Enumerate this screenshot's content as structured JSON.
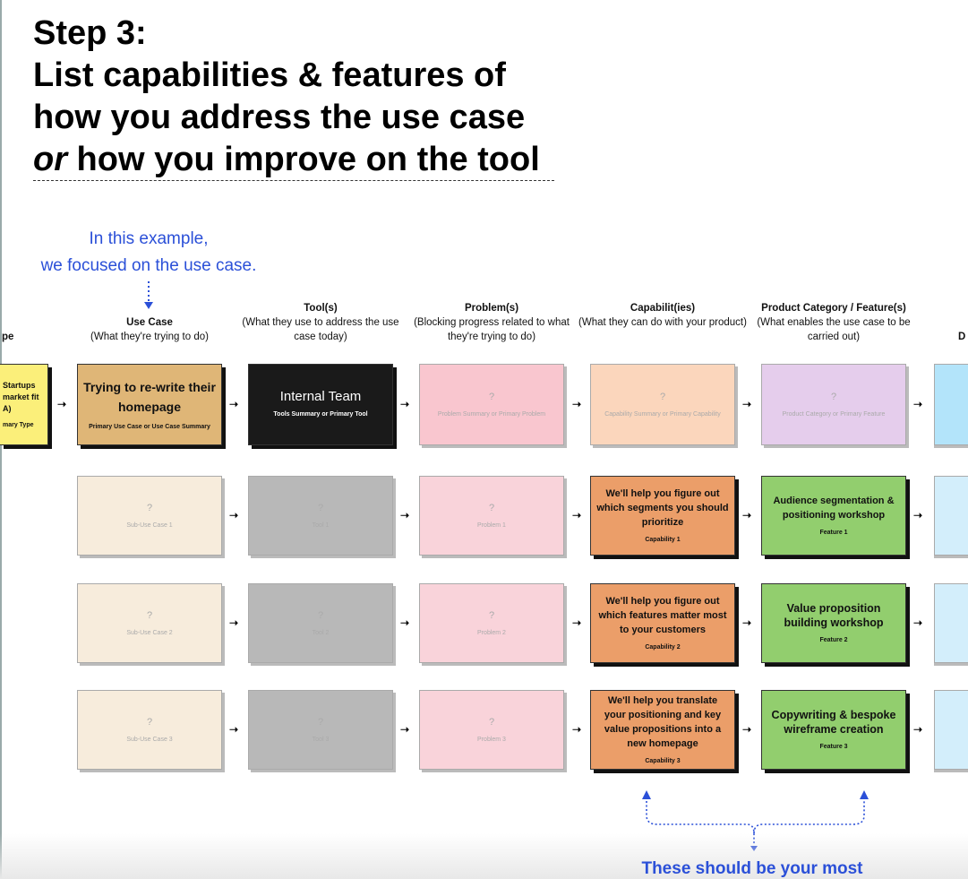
{
  "title": {
    "line1": "Step 3:",
    "line2": "List capabilities & features of",
    "line3": "how you address the use case",
    "line4_em": "or",
    "line4_rest": " how you improve on the tool"
  },
  "note": {
    "line1": "In this example,",
    "line2": "we focused on the use case."
  },
  "bottom_note": "These should be your most",
  "headers": [
    {
      "title": "",
      "desc": "pe"
    },
    {
      "title": "Use Case",
      "desc": "(What they're trying to do)"
    },
    {
      "title": "Tool(s)",
      "desc": "(What they use to address the use case today)"
    },
    {
      "title": "Problem(s)",
      "desc": "(Blocking progress related to what they're trying to do)"
    },
    {
      "title": "Capabilit(ies)",
      "desc": "(What they can do with your product)"
    },
    {
      "title": "Product Category / Feature(s)",
      "desc": "(What enables the use case to be carried out)"
    },
    {
      "title": "",
      "desc": "D"
    }
  ],
  "segment_card": {
    "main": "Startups market fit A)",
    "sub": "mary Type",
    "color": "#fbef7a"
  },
  "rows": [
    [
      {
        "main": "Trying to re-write their homepage",
        "sub": "Primary Use Case or Use Case Summary",
        "color": "#dfb677"
      },
      {
        "main": "Internal Team",
        "sub": "Tools Summary or Primary Tool",
        "color": "#1a1a1a"
      },
      {
        "main": "?",
        "sub": "Problem Summary or Primary Problem",
        "color": "#f9c6cf"
      },
      {
        "main": "?",
        "sub": "Capability Summary or Primary Capability",
        "color": "#fbd6bc"
      },
      {
        "main": "?",
        "sub": "Product Category or Primary Feature",
        "color": "#e5cdec"
      }
    ],
    [
      {
        "main": "?",
        "sub": "Sub-Use Case 1",
        "color": "#f7ecdc"
      },
      {
        "main": "?",
        "sub": "Tool 1",
        "color": "#b8b8b8"
      },
      {
        "main": "?",
        "sub": "Problem 1",
        "color": "#f9d3da"
      },
      {
        "main": "We'll help you figure out which segments you should prioritize",
        "sub": "Capability 1",
        "color": "#eb9e69"
      },
      {
        "main": "Audience segmentation & positioning workshop",
        "sub": "Feature 1",
        "color": "#92ce6e"
      }
    ],
    [
      {
        "main": "?",
        "sub": "Sub-Use Case 2",
        "color": "#f7ecdc"
      },
      {
        "main": "?",
        "sub": "Tool 2",
        "color": "#b8b8b8"
      },
      {
        "main": "?",
        "sub": "Problem 2",
        "color": "#f9d3da"
      },
      {
        "main": "We'll help you figure out which features matter most to your customers",
        "sub": "Capability 2",
        "color": "#eb9e69"
      },
      {
        "main": "Value proposition building workshop",
        "sub": "Feature 2",
        "color": "#92ce6e"
      }
    ],
    [
      {
        "main": "?",
        "sub": "Sub-Use Case 3",
        "color": "#f7ecdc"
      },
      {
        "main": "?",
        "sub": "Tool 3",
        "color": "#b8b8b8"
      },
      {
        "main": "?",
        "sub": "Problem 3",
        "color": "#f9d3da"
      },
      {
        "main": "We'll help you translate your positioning and key value propositions into a new homepage",
        "sub": "Capability 3",
        "color": "#eb9e69"
      },
      {
        "main": "Copywriting & bespoke wireframe creation",
        "sub": "Feature 3",
        "color": "#92ce6e"
      }
    ]
  ],
  "blue_cards": [
    "#b3e4fa",
    "#d3eefb",
    "#d3eefb",
    "#d3eefb"
  ],
  "accent": "#2b50d8"
}
